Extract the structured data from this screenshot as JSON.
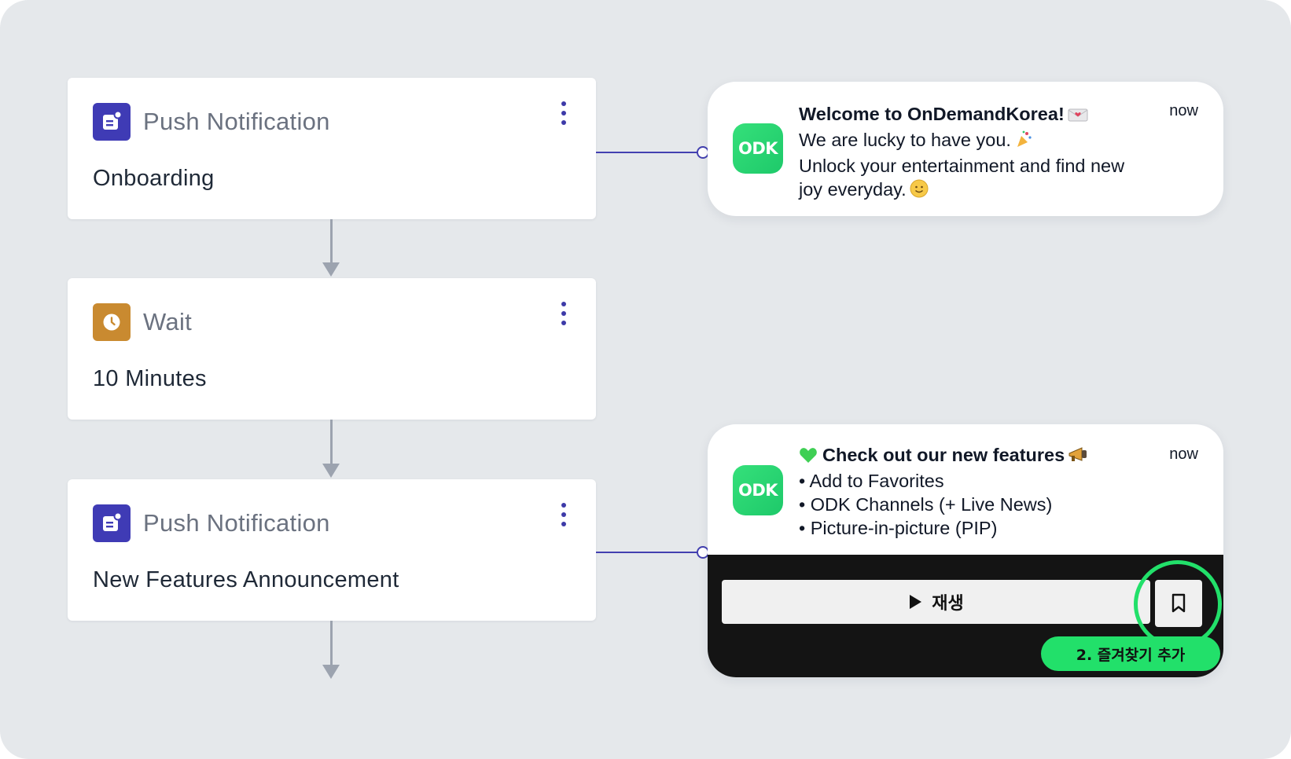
{
  "flow": {
    "steps": [
      {
        "type": "Push Notification",
        "name": "Onboarding",
        "icon": "message-icon",
        "icon_color": "#3f3bb5"
      },
      {
        "type": "Wait",
        "name": "10 Minutes",
        "icon": "clock-icon",
        "icon_color": "#c98a30"
      },
      {
        "type": "Push Notification",
        "name": "New Features Announcement",
        "icon": "message-icon",
        "icon_color": "#3f3bb5"
      }
    ]
  },
  "notifications": [
    {
      "app_logo": "ODK",
      "time": "now",
      "title": "Welcome to OnDemandKorea!",
      "lines": [
        "We are lucky to have you.",
        "Unlock your entertainment and find new",
        "joy everyday."
      ]
    },
    {
      "app_logo": "ODK",
      "time": "now",
      "title": "Check out our new features",
      "lines": [
        "• Add to Favorites",
        "• ODK Channels (+ Live News)",
        "• Picture-in-picture (PIP)"
      ],
      "play_label": "재생",
      "tooltip": "2. 즐겨찾기 추가"
    }
  ],
  "colors": {
    "canvas": "#e5e8eb",
    "connector": "#4340b0",
    "accent_green": "#22e06a"
  }
}
